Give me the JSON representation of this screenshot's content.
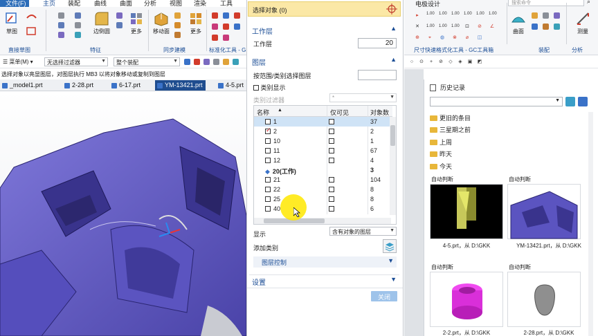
{
  "ribbon": {
    "tabs": [
      {
        "label": "文件(F)"
      },
      {
        "label": "主页"
      },
      {
        "label": "装配"
      },
      {
        "label": "曲线"
      },
      {
        "label": "曲面"
      },
      {
        "label": "分析"
      },
      {
        "label": "视图"
      },
      {
        "label": "渲染"
      },
      {
        "label": "工具"
      }
    ],
    "buttons": {
      "sketch": "草图",
      "edge_blend": "边倒圆",
      "more1": "更多",
      "move_face": "移动面",
      "more2": "更多"
    },
    "groups": {
      "direct_sketch": "直接草图",
      "feature": "特征",
      "sync_modeling": "同步建模",
      "standardize": "标准化工具 - G"
    }
  },
  "toolbar2": {
    "menu": "菜单(M)",
    "filter": "无选择过滤器",
    "assembly": "整个装配"
  },
  "status_text": "选择对象以亮显图层，对图层执行 MB3 以将对象移动或复制到图层",
  "file_tabs": [
    {
      "label": "_model1.prt"
    },
    {
      "label": "2-28.prt"
    },
    {
      "label": "6-17.prt"
    },
    {
      "label": "YM-13421.prt"
    },
    {
      "label": "4-5.prt"
    }
  ],
  "dialog": {
    "select_objects": "选择对象 (0)",
    "work_layer_section": "工作层",
    "work_layer_label": "工作层",
    "work_layer_value": "20",
    "layers_section": "图层",
    "select_by_range": "按范围/类别选择图层",
    "category_display": "类别显示",
    "category_filter": "类别过滤器",
    "category_filter_value": "*",
    "columns": {
      "name": "名称",
      "visible_only": "仅可见",
      "object_count": "对象数"
    },
    "layers": [
      {
        "name": "1",
        "checked": false,
        "visible_only": false,
        "count": "37"
      },
      {
        "name": "2",
        "checked": true,
        "visible_only": false,
        "count": "2"
      },
      {
        "name": "10",
        "checked": false,
        "visible_only": false,
        "count": "1"
      },
      {
        "name": "11",
        "checked": false,
        "visible_only": false,
        "count": "67"
      },
      {
        "name": "12",
        "checked": false,
        "visible_only": false,
        "count": "4"
      },
      {
        "name": "20(工作)",
        "checked": false,
        "visible_only": false,
        "count": "3"
      },
      {
        "name": "21",
        "checked": false,
        "visible_only": false,
        "count": "104"
      },
      {
        "name": "22",
        "checked": false,
        "visible_only": false,
        "count": "8"
      },
      {
        "name": "25",
        "checked": false,
        "visible_only": false,
        "count": "8"
      },
      {
        "name": "40",
        "checked": false,
        "visible_only": false,
        "count": "6"
      }
    ],
    "display_label": "显示",
    "display_value": "含有对象的图层",
    "add_category": "添加类别",
    "layer_control": "图层控制",
    "settings": "设置",
    "apply": "关闭"
  },
  "right_ribbon": {
    "tab": "电极设计",
    "search_placeholder": "搜索命令",
    "surface": "曲面",
    "measure": "测量",
    "dim_tool_group": "尺寸快速格式化工具 - GC工具箱",
    "assembly_group": "装配",
    "analysis_group": "分析"
  },
  "history": {
    "title": "历史记录",
    "folders": [
      "更旧的条目",
      "三星期之前",
      "上周",
      "昨天",
      "今天"
    ],
    "thumbs": [
      {
        "group": "自动判断",
        "caption": "4-5.prt，从 D:\\GKK"
      },
      {
        "group": "自动判断",
        "caption": "YM-13421.prt，从 D:\\GKK"
      },
      {
        "group": "自动判断",
        "caption": "2-2.prt，从 D:\\GKK"
      },
      {
        "group": "自动判断",
        "caption": "2-28.prt，从 D:\\GKK"
      }
    ]
  },
  "colors": {
    "accent_blue": "#1c4e96",
    "select_bar": "#fbe8a6",
    "model_purple": "#6b63c9",
    "apply_button": "#9ec3ea"
  }
}
